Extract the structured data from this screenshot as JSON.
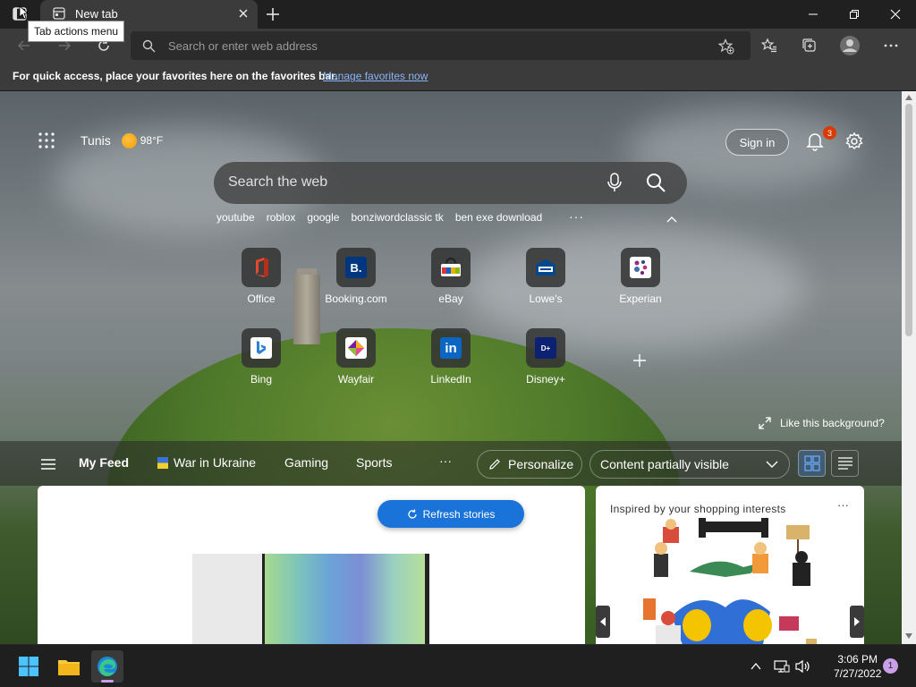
{
  "browser": {
    "tab_title": "New tab",
    "tooltip": "Tab actions menu",
    "address_placeholder": "Search or enter web address",
    "favbar_text": "For quick access, place your favorites here on the favorites bar.",
    "favbar_link": "Manage favorites now"
  },
  "ntp": {
    "city": "Tunis",
    "temperature": "98°F",
    "sign_in": "Sign in",
    "notification_count": "3",
    "search_placeholder": "Search the web",
    "suggestions": [
      "youtube",
      "roblox",
      "google",
      "bonziwordclassic tk",
      "ben exe download"
    ],
    "more": "···",
    "tiles": [
      {
        "label": "Office",
        "icon": "office-icon",
        "color": "#d83b01"
      },
      {
        "label": "Booking.com",
        "icon": "booking-icon",
        "color": "#003580"
      },
      {
        "label": "eBay",
        "icon": "ebay-icon",
        "color": "#e53238"
      },
      {
        "label": "Lowe's",
        "icon": "lowes-icon",
        "color": "#004990"
      },
      {
        "label": "Experian",
        "icon": "experian-icon",
        "color": "#ffffff"
      },
      {
        "label": "Bing",
        "icon": "bing-icon",
        "color": "#ffffff"
      },
      {
        "label": "Wayfair",
        "icon": "wayfair-icon",
        "color": "#7b189f"
      },
      {
        "label": "LinkedIn",
        "icon": "linkedin-icon",
        "color": "#0a66c2"
      },
      {
        "label": "Disney+",
        "icon": "disney-icon",
        "color": "#0d2173"
      }
    ],
    "like_background": "Like this background?"
  },
  "feed": {
    "tabs": [
      "My Feed",
      "War in Ukraine",
      "Gaming",
      "Sports"
    ],
    "more": "···",
    "personalize": "Personalize",
    "content_visibility": "Content partially visible",
    "refresh": "Refresh stories",
    "shopping_title": "Inspired by your shopping interests",
    "card_more": "···"
  },
  "taskbar": {
    "time": "3:06 PM",
    "date": "7/27/2022",
    "notification_count": "1"
  },
  "colors": {
    "accent": "#1a73d9",
    "badge": "#d83b01"
  }
}
